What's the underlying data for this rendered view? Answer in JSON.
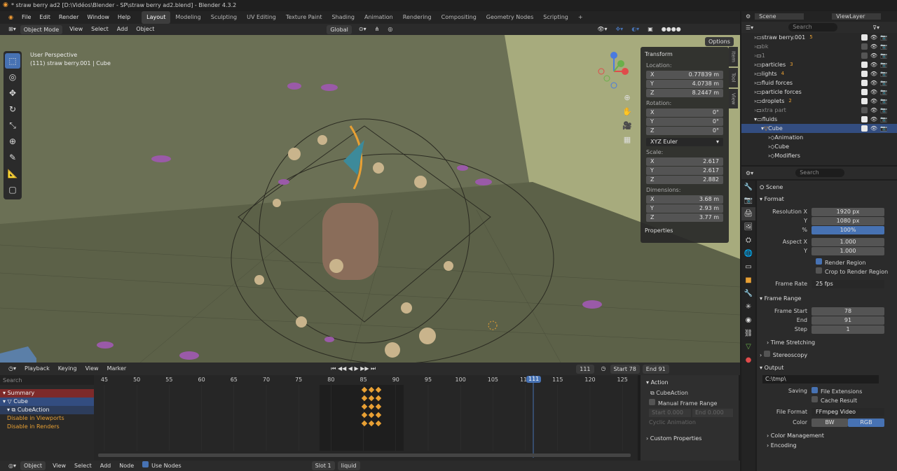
{
  "title": "* straw berry ad2 [D:\\Vidéos\\Blender - SP\\straw berry ad2.blend] - Blender 4.3.2",
  "menu": [
    "File",
    "Edit",
    "Render",
    "Window",
    "Help"
  ],
  "workspaces": [
    "Layout",
    "Modeling",
    "Sculpting",
    "UV Editing",
    "Texture Paint",
    "Shading",
    "Animation",
    "Rendering",
    "Compositing",
    "Geometry Nodes",
    "Scripting"
  ],
  "viewport_header": {
    "mode": "Object Mode",
    "items": [
      "View",
      "Select",
      "Add",
      "Object"
    ],
    "orientation": "Global",
    "options": "Options"
  },
  "viewport_info": {
    "line1": "User Perspective",
    "line2": "(111) straw berry.001 | Cube"
  },
  "npanel": {
    "transform": "Transform",
    "location_label": "Location:",
    "loc": [
      {
        "a": "X",
        "v": "0.77839 m"
      },
      {
        "a": "Y",
        "v": "4.0738 m"
      },
      {
        "a": "Z",
        "v": "8.2447 m"
      }
    ],
    "rotation_label": "Rotation:",
    "rot": [
      {
        "a": "X",
        "v": "0°"
      },
      {
        "a": "Y",
        "v": "0°"
      },
      {
        "a": "Z",
        "v": "0°"
      }
    ],
    "rotation_mode": "XYZ Euler",
    "scale_label": "Scale:",
    "scale": [
      {
        "a": "X",
        "v": "2.617"
      },
      {
        "a": "Y",
        "v": "2.617"
      },
      {
        "a": "Z",
        "v": "2.882"
      }
    ],
    "dimensions_label": "Dimensions:",
    "dim": [
      {
        "a": "X",
        "v": "3.68 m"
      },
      {
        "a": "Y",
        "v": "2.93 m"
      },
      {
        "a": "Z",
        "v": "3.77 m"
      }
    ],
    "properties": "Properties",
    "tabs": [
      "Item",
      "Tool",
      "View"
    ]
  },
  "timeline_header": {
    "items": [
      "Playback",
      "Keying",
      "View",
      "Marker"
    ],
    "current": "111",
    "start_label": "Start",
    "start": "78",
    "end_label": "End",
    "end": "91"
  },
  "timeline": {
    "search": "Search",
    "ticks": [
      "45",
      "50",
      "55",
      "60",
      "65",
      "70",
      "75",
      "80",
      "85",
      "90",
      "95",
      "100",
      "105",
      "110",
      "115",
      "120",
      "125"
    ],
    "current_frame": "111",
    "channels": [
      "Summary",
      "Cube",
      "CubeAction",
      "Disable in Viewports",
      "Disable in Renders"
    ]
  },
  "action_panel": {
    "title": "Action",
    "action": "CubeAction",
    "manual": "Manual Frame Range",
    "start_label": "Start",
    "start": "0.000",
    "end_label": "End",
    "end": "0.000",
    "cyclic": "Cyclic Animation",
    "custom": "Custom Properties"
  },
  "bottom_header": {
    "mode": "Object",
    "items": [
      "View",
      "Select",
      "Add",
      "Node"
    ],
    "use_nodes": "Use Nodes",
    "slot": "Slot 1",
    "material": "liquid"
  },
  "outliner": {
    "scene": "Scene",
    "viewlayer": "ViewLayer",
    "search": "Search",
    "rows": [
      {
        "name": "straw berry.001",
        "badge": "5",
        "dim": false
      },
      {
        "name": "bk",
        "badge": "",
        "dim": true
      },
      {
        "name": "1",
        "badge": "",
        "dim": true
      },
      {
        "name": "particles",
        "badge": "3",
        "dim": false
      },
      {
        "name": "lights",
        "badge": "4",
        "dim": false
      },
      {
        "name": "fluid forces",
        "badge": "",
        "dim": false
      },
      {
        "name": "particle forces",
        "badge": "",
        "dim": false
      },
      {
        "name": "droplets",
        "badge": "2",
        "dim": false
      },
      {
        "name": "xtra part",
        "badge": "",
        "dim": true
      },
      {
        "name": "fluids",
        "badge": "",
        "dim": false
      },
      {
        "name": "Cube",
        "badge": "",
        "dim": false
      },
      {
        "name": "Animation",
        "badge": "",
        "dim": false
      },
      {
        "name": "Cube",
        "badge": "",
        "dim": false
      },
      {
        "name": "Modifiers",
        "badge": "",
        "dim": false
      }
    ]
  },
  "properties": {
    "search": "Search",
    "scene": "Scene",
    "format": "Format",
    "res_x_label": "Resolution X",
    "res_x": "1920 px",
    "res_y_label": "Y",
    "res_y": "1080 px",
    "pct_label": "%",
    "pct": "100%",
    "aspect_x_label": "Aspect X",
    "aspect_x": "1.000",
    "aspect_y_label": "Y",
    "aspect_y": "1.000",
    "render_region": "Render Region",
    "crop": "Crop to Render Region",
    "frame_rate_label": "Frame Rate",
    "frame_rate": "25 fps",
    "frame_range": "Frame Range",
    "frame_start_label": "Frame Start",
    "frame_start": "78",
    "end_label": "End",
    "end": "91",
    "step_label": "Step",
    "step": "1",
    "time_stretching": "Time Stretching",
    "stereoscopy": "Stereoscopy",
    "output": "Output",
    "path": "C:\\tmp\\",
    "saving_label": "Saving",
    "file_ext": "File Extensions",
    "cache": "Cache Result",
    "file_format_label": "File Format",
    "file_format": "FFmpeg Video",
    "color_label": "Color",
    "bw": "BW",
    "rgb": "RGB",
    "color_management": "Color Management",
    "encoding": "Encoding"
  },
  "colors": {
    "accent": "#4772b3",
    "select": "#334d80",
    "orange": "#e8a034",
    "viewport": "#6b7055"
  }
}
